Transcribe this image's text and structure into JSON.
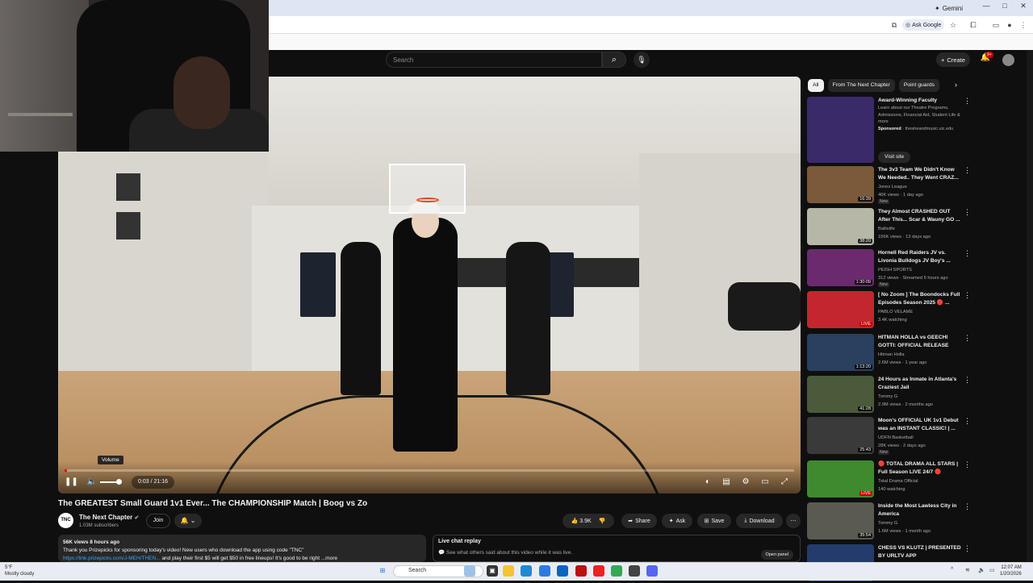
{
  "browser": {
    "gemini_label": "Gemini",
    "ask_google_label": "Ask Google",
    "window_controls": [
      "—",
      "□",
      "✕"
    ]
  },
  "header": {
    "search_placeholder": "Search",
    "create_label": "Create",
    "notif_count": "9+"
  },
  "player": {
    "volume_tooltip": "Volume",
    "time": "0:03 / 21:16",
    "progress_fraction": 0.003
  },
  "video": {
    "title": "The GREATEST Small Guard 1v1 Ever... The CHAMPIONSHIP Match | Boog vs Zo",
    "channel_name": "The Next Chapter",
    "channel_avatar_text": "TNC",
    "subscribers": "1.03M subscribers",
    "join_label": "Join",
    "likes": "3.9K",
    "share_label": "Share",
    "ask_label": "Ask",
    "save_label": "Save",
    "download_label": "Download"
  },
  "description": {
    "meta": "56K views  8 hours ago",
    "line1": "Thank you Prizepicks for sponsoring today's video! New users who download the app using code \"TNC\"",
    "link": "https://link.prizepicks.com/J-MEH/THEN...",
    "line2": " and play their first $5 will get $50 in free lineups! It's good to be right",
    "more": "...more"
  },
  "live_chat": {
    "title": "Live chat replay",
    "subtitle": "See what others said about this video while it was live.",
    "open_panel": "Open panel"
  },
  "chips": [
    "All",
    "From The Next Chapter",
    "Point guards"
  ],
  "ad": {
    "title": "Award-Winning Faculty",
    "description": "Learn about our Theatre Programs, Admissions, Financial Aid, Student Life & more",
    "sponsored": "Sponsored",
    "domain": "· thestreandmusic.uic.edu",
    "visit_site": "Visit site"
  },
  "recommendations": [
    {
      "title": "The 3v3 Team We Didn't Know We Needed.. They Went CRAZ...",
      "channel": "Jones League",
      "meta": "46K views · 1 day ago",
      "new": "New",
      "duration": "16:39",
      "thumb": "#7a5a3a"
    },
    {
      "title": "They Almost CRASHED OUT After This... Scar & Wauny GO ...",
      "channel": "Ballislife",
      "meta": "156K views · 13 days ago",
      "duration": "38:20",
      "thumb": "#b7b7a8"
    },
    {
      "title": "Hornell Red Raiders JV vs. Livonia Bulldogs JV Boy's ...",
      "channel": "PEISH SPORTS",
      "meta": "312 views · Streamed 5 hours ago",
      "new": "New",
      "duration": "1:30:09",
      "thumb": "#6b2a6e"
    },
    {
      "title": "[ No Zoom ] The Boondocks Full Episodes Season 2025 🔴 ...",
      "channel": "PABLO VELAME",
      "meta": "3.4K watching",
      "duration": "LIVE",
      "live": true,
      "thumb": "#c4262e"
    },
    {
      "title": "HITMAN HOLLA vs GEECHI GOTTI: OFFICIAL RELEASE",
      "channel": "Hitman Holla",
      "meta": "2.6M views · 1 year ago",
      "duration": "1:13:20",
      "thumb": "#2b3f5e"
    },
    {
      "title": "24 Hours as Inmate in Atlanta's Craziest Jail",
      "channel": "Tommy G",
      "meta": "2.9M views · 2 months ago",
      "duration": "41:28",
      "thumb": "#4a5a3a"
    },
    {
      "title": "Moon's OFFICIAL UK 1v1 Debut was an INSTANT CLASSIC! | ...",
      "channel": "UDFN Basketball",
      "meta": "28K views · 2 days ago",
      "new": "New",
      "duration": "25:43",
      "thumb": "#3a3a3a"
    },
    {
      "title": "🔴 TOTAL DRAMA ALL STARS | Full Season LIVE 24/7 🔴",
      "channel": "Total Drama Official",
      "meta": "140 watching",
      "duration": "LIVE",
      "live": true,
      "thumb": "#3f8a2e"
    },
    {
      "title": "Inside the Most Lawless City in America",
      "channel": "Tommy G",
      "meta": "1.6M views · 1 month ago",
      "duration": "35:54",
      "thumb": "#5a5a52"
    },
    {
      "title": "CHESS VS KLUTZ | PRESENTED BY URLTV APP",
      "channel": "",
      "meta": "",
      "duration": "",
      "thumb": "#233c6b"
    }
  ],
  "taskbar": {
    "weather_temp": "5°F",
    "weather_text": "Mostly cloudy",
    "search_label": "Search",
    "time": "12:07 AM",
    "date": "1/20/2026"
  },
  "colors": {
    "background": "#0f0f0f",
    "progress": "#ff0000",
    "link": "#3ea6ff"
  }
}
